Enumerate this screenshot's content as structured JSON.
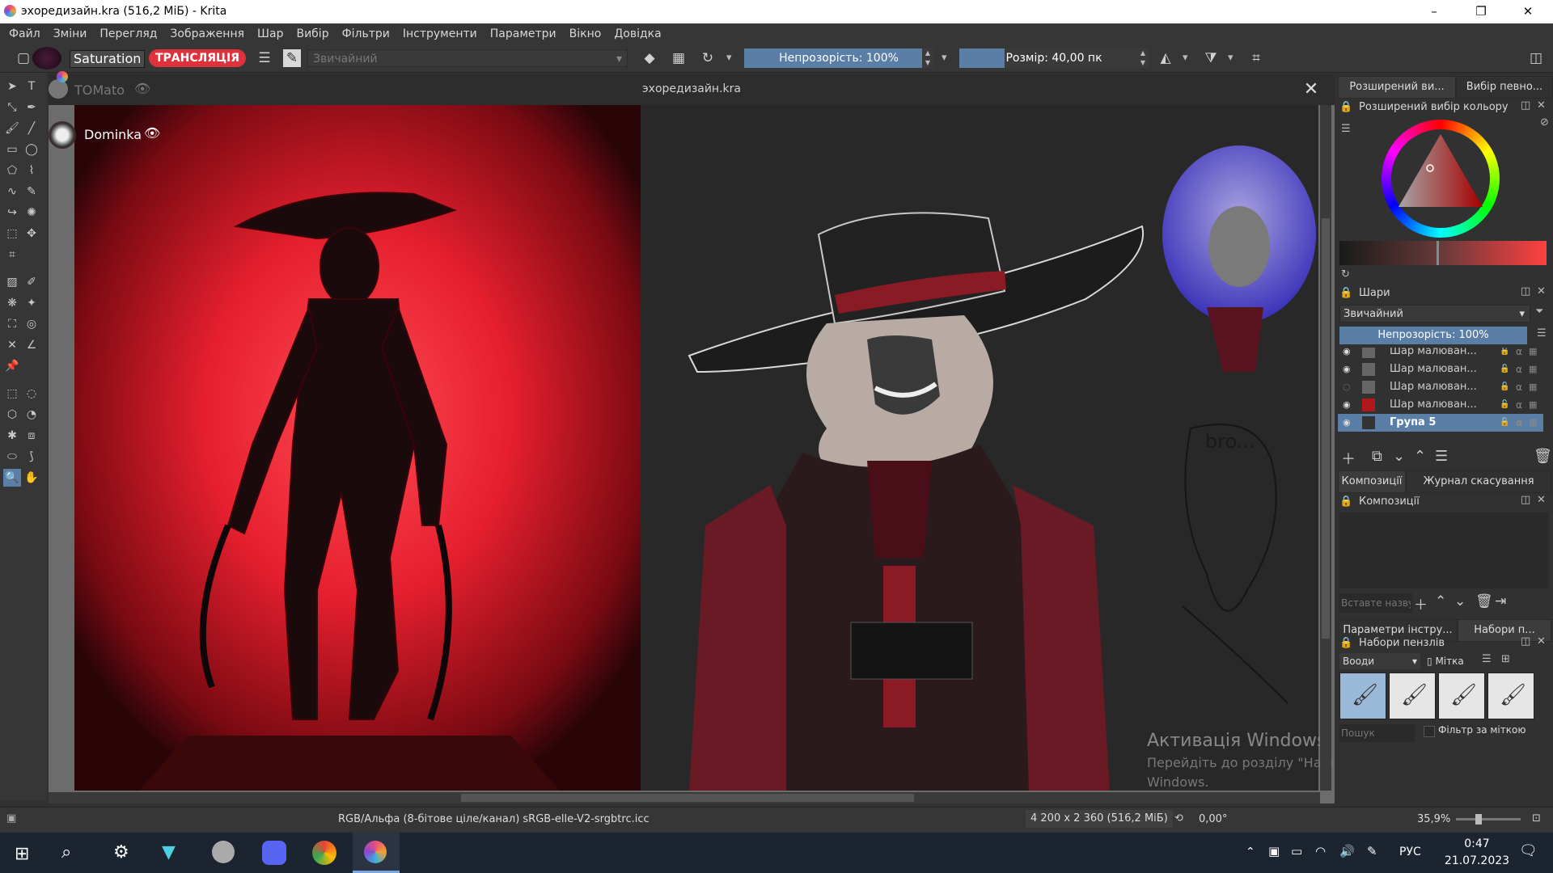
{
  "window": {
    "title": "эхоредизайн.kra (516,2 МіБ)  - Krita",
    "minimize": "–",
    "maximize": "❐",
    "close": "✕"
  },
  "menu": [
    "Файл",
    "Зміни",
    "Перегляд",
    "Зображення",
    "Шар",
    "Вибір",
    "Фільтри",
    "Інструменти",
    "Параметри",
    "Вікно",
    "Довідка"
  ],
  "toolbar": {
    "blend_mode_label": "Saturation",
    "stream_label": "ТРАНСЛЯЦІЯ",
    "preset_name": "Звичайний",
    "opacity": "Непрозорість: 100%",
    "size": "Розмір: 40,00 пк"
  },
  "canvas": {
    "doc_title": "эхоредизайн.kra",
    "user1": "TOMato",
    "user2": "Dominka",
    "sketch_text": "bro...",
    "watermark_title": "Активація Windows",
    "watermark_line1": "Перейдіть до розділу \"Настройки\", щоб активувати",
    "watermark_line2": "Windows."
  },
  "docker": {
    "tab_color1": "Розширений ви...",
    "tab_color2": "Вибір певно...",
    "color_title": "Розширений вибір кольору",
    "layers_title": "Шари",
    "layers_blend": "Звичайний",
    "layers_opacity": "Непрозорість:  100%",
    "layers": [
      {
        "name": "Шар малюван...",
        "visible": true
      },
      {
        "name": "Шар малюван...",
        "visible": true
      },
      {
        "name": "Шар малюван...",
        "visible": false
      },
      {
        "name": "Шар малюван...",
        "visible": true
      },
      {
        "name": "Група 5",
        "visible": true,
        "selected": true
      }
    ],
    "tab_comp": "Композиції",
    "tab_undo": "Журнал скасування",
    "comp_title": "Композиції",
    "comp_placeholder": "Вставте назву",
    "tab_tool_options": "Параметри інстру...",
    "tab_brush_sets": "Набори п...",
    "brush_title": "Набори пензлів",
    "brush_set": "Вооди",
    "brush_tag": "Мітка",
    "search_placeholder": "Пошук",
    "filter_by_tag": "Фільтр за міткою"
  },
  "status": {
    "color_space": "RGB/Альфа (8-бітове ціле/канал)  sRGB-elle-V2-srgbtrc.icc",
    "dims": "4 200 x 2 360 (516,2 МіБ)",
    "rotation": "0,00°",
    "zoom": "35,9%"
  },
  "taskbar": {
    "lang": "РУС",
    "time": "0:47",
    "date": "21.07.2023"
  },
  "colors": {
    "accent": "#4d7fb5",
    "stream_red": "#e0323c",
    "panel": "#363636",
    "canvas_bg": "#2c2c2c"
  }
}
